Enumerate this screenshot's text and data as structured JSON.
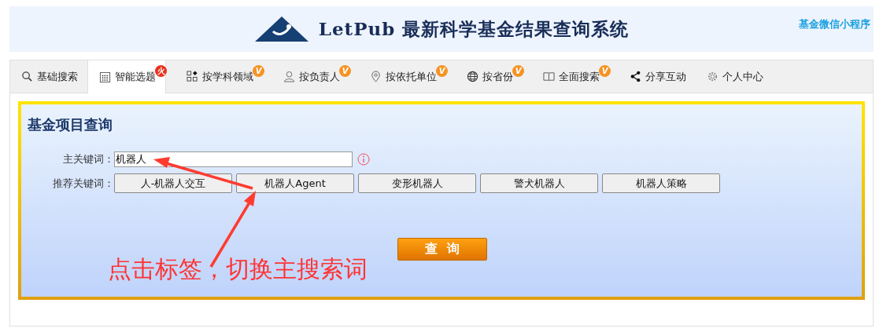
{
  "header": {
    "logo_text": "LetPub",
    "title": "最新科学基金结果查询系统",
    "link": "基金微信小程序"
  },
  "tabs": [
    {
      "label": "基础搜索",
      "selected": false
    },
    {
      "label": "智能选题",
      "selected": true,
      "badge": {
        "kind": "hot",
        "text": "火"
      }
    },
    {
      "label": "按学科领域",
      "selected": false,
      "badge": {
        "kind": "vip",
        "text": "V"
      }
    },
    {
      "label": "按负责人",
      "selected": false,
      "badge": {
        "kind": "vip",
        "text": "V"
      }
    },
    {
      "label": "按依托单位",
      "selected": false,
      "badge": {
        "kind": "vip",
        "text": "V"
      }
    },
    {
      "label": "按省份",
      "selected": false,
      "badge": {
        "kind": "vip",
        "text": "V"
      }
    },
    {
      "label": "全面搜索",
      "selected": false,
      "badge": {
        "kind": "vip",
        "text": "V"
      }
    },
    {
      "label": "分享互动",
      "selected": false
    },
    {
      "label": "个人中心",
      "selected": false
    }
  ],
  "panel": {
    "title": "基金项目查询",
    "keyword_label": "主关键词：",
    "keyword_value": "机器人",
    "suggest_label": "推荐关键词：",
    "suggestions": [
      "人-机器人交互",
      "机器人Agent",
      "变形机器人",
      "警犬机器人",
      "机器人策略"
    ],
    "submit": "查  询",
    "annotation": "点击标签，切换主搜索词"
  }
}
